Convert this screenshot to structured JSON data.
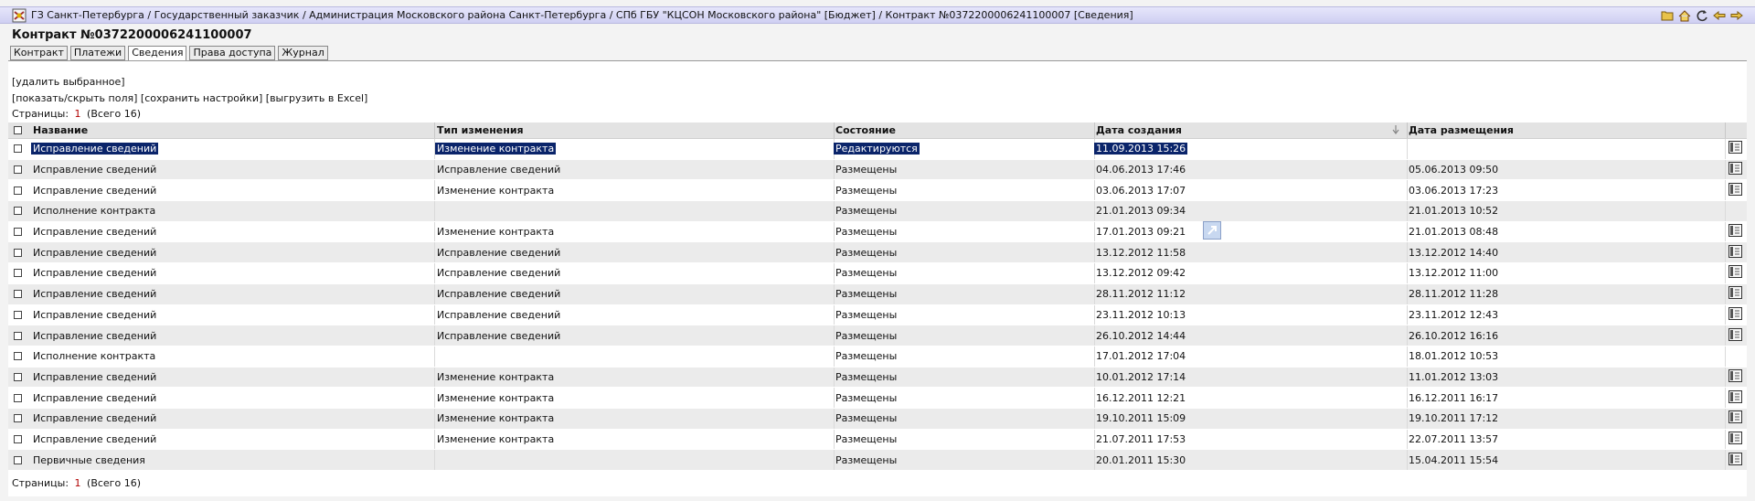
{
  "breadcrumb": "ГЗ Санкт-Петербурга / Государственный заказчик / Администрация Московского района Санкт-Петербурга / СПб ГБУ \"КЦСОН Московского района\" [Бюджет] / Контракт №0372200006241100007 [Сведения]",
  "page_title": "Контракт №0372200006241100007",
  "tabs": [
    "Контракт",
    "Платежи",
    "Сведения",
    "Права доступа",
    "Журнал"
  ],
  "active_tab": "Сведения",
  "commands": {
    "delete_selected": "[удалить выбранное]",
    "show_hide_fields": "[показать/скрыть поля]",
    "save_settings": "[сохранить настройки]",
    "export_excel": "[выгрузить в Excel]"
  },
  "pagination": {
    "label": "Страницы:",
    "current": "1",
    "total": "(Всего 16)"
  },
  "columns": [
    "Название",
    "Тип изменения",
    "Состояние",
    "Дата создания",
    "Дата размещения"
  ],
  "rows": [
    {
      "name": "Исправление сведений",
      "type": "Изменение контракта",
      "state": "Редактируются",
      "created": "11.09.2013 15:26",
      "placed": "",
      "doc": true
    },
    {
      "name": "Исправление сведений",
      "type": "Исправление сведений",
      "state": "Размещены",
      "created": "04.06.2013 17:46",
      "placed": "05.06.2013 09:50",
      "doc": true
    },
    {
      "name": "Исправление сведений",
      "type": "Изменение контракта",
      "state": "Размещены",
      "created": "03.06.2013 17:07",
      "placed": "03.06.2013 17:23",
      "doc": true
    },
    {
      "name": "Исполнение контракта",
      "type": "",
      "state": "Размещены",
      "created": "21.01.2013 09:34",
      "placed": "21.01.2013 10:52",
      "doc": false
    },
    {
      "name": "Исправление сведений",
      "type": "Изменение контракта",
      "state": "Размещены",
      "created": "17.01.2013 09:21",
      "placed": "21.01.2013 08:48",
      "doc": true
    },
    {
      "name": "Исправление сведений",
      "type": "Исправление сведений",
      "state": "Размещены",
      "created": "13.12.2012 11:58",
      "placed": "13.12.2012 14:40",
      "doc": true
    },
    {
      "name": "Исправление сведений",
      "type": "Исправление сведений",
      "state": "Размещены",
      "created": "13.12.2012 09:42",
      "placed": "13.12.2012 11:00",
      "doc": true
    },
    {
      "name": "Исправление сведений",
      "type": "Исправление сведений",
      "state": "Размещены",
      "created": "28.11.2012 11:12",
      "placed": "28.11.2012 11:28",
      "doc": true
    },
    {
      "name": "Исправление сведений",
      "type": "Исправление сведений",
      "state": "Размещены",
      "created": "23.11.2012 10:13",
      "placed": "23.11.2012 12:43",
      "doc": true
    },
    {
      "name": "Исправление сведений",
      "type": "Исправление сведений",
      "state": "Размещены",
      "created": "26.10.2012 14:44",
      "placed": "26.10.2012 16:16",
      "doc": true
    },
    {
      "name": "Исполнение контракта",
      "type": "",
      "state": "Размещены",
      "created": "17.01.2012 17:04",
      "placed": "18.01.2012 10:53",
      "doc": false
    },
    {
      "name": "Исправление сведений",
      "type": "Изменение контракта",
      "state": "Размещены",
      "created": "10.01.2012 17:14",
      "placed": "11.01.2012 13:03",
      "doc": true
    },
    {
      "name": "Исправление сведений",
      "type": "Изменение контракта",
      "state": "Размещены",
      "created": "16.12.2011 12:21",
      "placed": "16.12.2011 16:17",
      "doc": true
    },
    {
      "name": "Исправление сведений",
      "type": "Изменение контракта",
      "state": "Размещены",
      "created": "19.10.2011 15:09",
      "placed": "19.10.2011 17:12",
      "doc": true
    },
    {
      "name": "Исправление сведений",
      "type": "Изменение контракта",
      "state": "Размещены",
      "created": "21.07.2011 17:53",
      "placed": "22.07.2011 13:57",
      "doc": true
    },
    {
      "name": "Первичные сведения",
      "type": "",
      "state": "Размещены",
      "created": "20.01.2011 15:30",
      "placed": "15.04.2011 15:54",
      "doc": true
    }
  ],
  "icons": {
    "toolbar": [
      "folder-icon",
      "home-icon",
      "refresh-icon",
      "back-arrow-icon",
      "forward-arrow-icon"
    ],
    "row_doc": "document-icon",
    "sort": "sort-desc-icon"
  },
  "colors": {
    "titlebar": "#d8d8f6",
    "selection": "#0a246a",
    "page_number": "#b00000",
    "row_alt": "#ebebeb"
  }
}
